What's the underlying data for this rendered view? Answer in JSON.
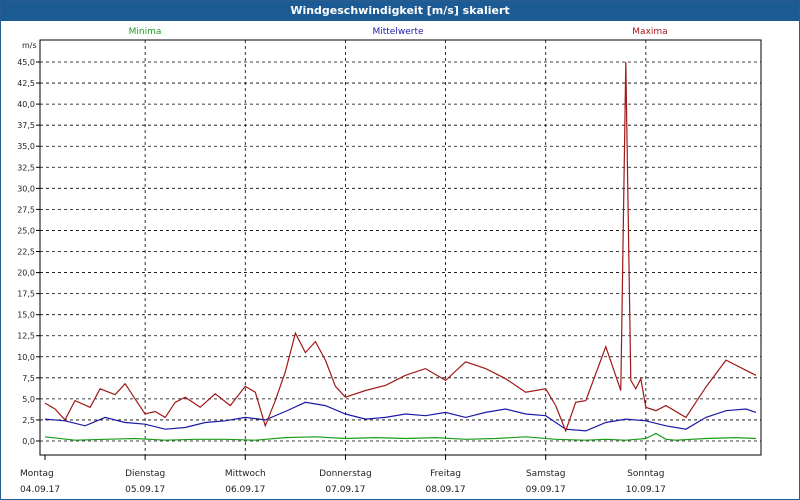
{
  "title": "Windgeschwindigkeit [m/s] skaliert",
  "chart_data": {
    "type": "line",
    "unit_label": "m/s",
    "ylim": [
      0,
      46.5
    ],
    "yticks": [
      "0,0",
      "2,5",
      "5,0",
      "7,5",
      "10,0",
      "12,5",
      "15,0",
      "17,5",
      "20,0",
      "22,5",
      "25,0",
      "27,5",
      "30,0",
      "32,5",
      "35,0",
      "37,5",
      "40,0",
      "42,5",
      "45,0"
    ],
    "ytick_values": [
      0,
      2.5,
      5,
      7.5,
      10,
      12.5,
      15,
      17.5,
      20,
      22.5,
      25,
      27.5,
      30,
      32.5,
      35,
      37.5,
      40,
      42.5,
      45
    ],
    "x_days": [
      {
        "day": "Montag",
        "date": "04.09.17"
      },
      {
        "day": "Dienstag",
        "date": "05.09.17"
      },
      {
        "day": "Mittwoch",
        "date": "06.09.17"
      },
      {
        "day": "Donnerstag",
        "date": "07.09.17"
      },
      {
        "day": "Freitag",
        "date": "08.09.17"
      },
      {
        "day": "Samstag",
        "date": "09.09.17"
      },
      {
        "day": "Sonntag",
        "date": "10.09.17"
      }
    ],
    "xlim": [
      0,
      7.1
    ],
    "grid": true,
    "series": [
      {
        "name": "Minima",
        "color": "#1a9e1a",
        "legend_pos": "left",
        "x": [
          0,
          0.3,
          0.6,
          0.9,
          1.2,
          1.5,
          1.8,
          2.1,
          2.4,
          2.7,
          3.0,
          3.3,
          3.6,
          3.9,
          4.2,
          4.5,
          4.8,
          5.1,
          5.4,
          5.6,
          5.8,
          6.0,
          6.1,
          6.2,
          6.3,
          6.6,
          6.9,
          7.1
        ],
        "y": [
          0.5,
          0.1,
          0.2,
          0.3,
          0.1,
          0.2,
          0.2,
          0.1,
          0.4,
          0.5,
          0.3,
          0.4,
          0.3,
          0.4,
          0.2,
          0.3,
          0.5,
          0.2,
          0.1,
          0.2,
          0.1,
          0.3,
          0.9,
          0.2,
          0.1,
          0.3,
          0.4,
          0.3
        ]
      },
      {
        "name": "Mittelwerte",
        "color": "#1a1aa8",
        "legend_pos": "center",
        "x": [
          0,
          0.2,
          0.4,
          0.6,
          0.8,
          1.0,
          1.2,
          1.4,
          1.6,
          1.8,
          2.0,
          2.2,
          2.4,
          2.6,
          2.8,
          3.0,
          3.2,
          3.4,
          3.6,
          3.8,
          4.0,
          4.2,
          4.4,
          4.6,
          4.8,
          5.0,
          5.2,
          5.4,
          5.6,
          5.8,
          6.0,
          6.2,
          6.4,
          6.6,
          6.8,
          7.0,
          7.1
        ],
        "y": [
          2.6,
          2.4,
          1.8,
          2.8,
          2.2,
          2.0,
          1.4,
          1.6,
          2.2,
          2.4,
          2.8,
          2.5,
          3.5,
          4.6,
          4.2,
          3.2,
          2.6,
          2.8,
          3.2,
          3.0,
          3.4,
          2.8,
          3.4,
          3.8,
          3.2,
          3.0,
          1.4,
          1.2,
          2.2,
          2.6,
          2.4,
          1.8,
          1.4,
          2.8,
          3.6,
          3.8,
          3.4
        ]
      },
      {
        "name": "Maxima",
        "color": "#a01818",
        "legend_pos": "right",
        "x": [
          0,
          0.1,
          0.2,
          0.3,
          0.45,
          0.55,
          0.7,
          0.8,
          0.9,
          1.0,
          1.1,
          1.2,
          1.3,
          1.4,
          1.55,
          1.7,
          1.85,
          2.0,
          2.1,
          2.2,
          2.3,
          2.4,
          2.5,
          2.6,
          2.7,
          2.8,
          2.9,
          3.0,
          3.2,
          3.4,
          3.6,
          3.8,
          4.0,
          4.2,
          4.4,
          4.6,
          4.8,
          5.0,
          5.1,
          5.2,
          5.3,
          5.4,
          5.6,
          5.75,
          5.8,
          5.85,
          5.9,
          5.95,
          6.0,
          6.05,
          6.1,
          6.2,
          6.4,
          6.6,
          6.8,
          7.0,
          7.1
        ],
        "y": [
          4.5,
          3.8,
          2.5,
          4.8,
          4.0,
          6.2,
          5.5,
          6.8,
          5.0,
          3.2,
          3.5,
          2.8,
          4.6,
          5.2,
          4.0,
          5.6,
          4.2,
          6.5,
          5.8,
          1.8,
          4.8,
          8.2,
          12.8,
          10.5,
          11.8,
          9.6,
          6.5,
          5.2,
          6.0,
          6.6,
          7.8,
          8.6,
          7.2,
          9.4,
          8.6,
          7.4,
          5.8,
          6.2,
          4.2,
          1.2,
          4.6,
          4.8,
          11.2,
          6.0,
          45.0,
          7.2,
          6.2,
          7.4,
          4.0,
          3.8,
          3.6,
          4.2,
          2.8,
          6.4,
          9.6,
          8.4,
          7.8
        ]
      }
    ]
  }
}
